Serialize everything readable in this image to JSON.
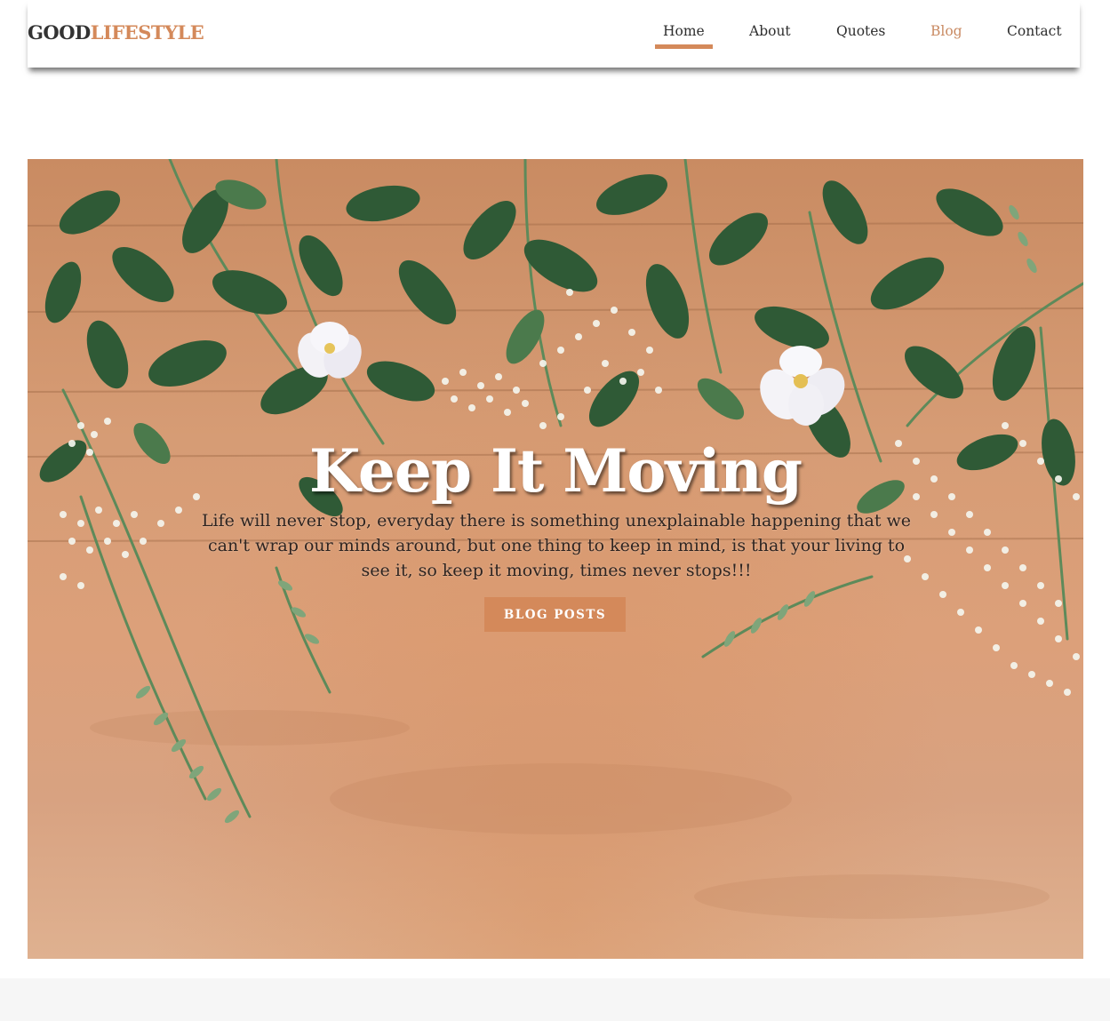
{
  "brand": {
    "part1": "GOOD",
    "part2": "LIFESTYLE"
  },
  "nav": {
    "home": "Home",
    "about": "About",
    "quotes": "Quotes",
    "blog": "Blog",
    "contact": "Contact",
    "active": "Home"
  },
  "hero": {
    "title": "Keep It Moving",
    "text": "Life will never stop, everyday there is something unexplainable happening that we can't wrap our minds around, but one thing to keep in mind, is that your living to see it, so keep it moving, times never stops!!!",
    "button_label": "BLOG POSTS"
  },
  "colors": {
    "accent": "#d4895a",
    "blog_link": "#c98a62",
    "text_dark": "#2e2e2e"
  }
}
